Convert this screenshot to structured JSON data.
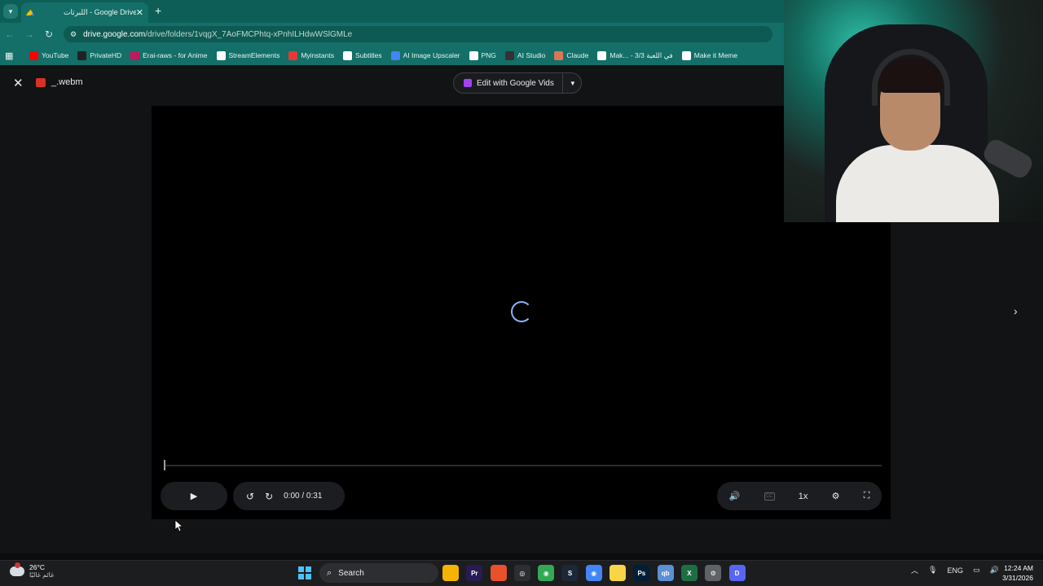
{
  "browser": {
    "tab_title": "اللبرتات - Google Drive",
    "tab_close": "✕",
    "new_tab": "+",
    "url_host": "drive.google.com",
    "url_path": "/drive/folders/1vqgX_7AoFMCPhtq-xPnhILHdwWSlGMLe",
    "bookmarks": [
      {
        "label": "YouTube",
        "color": "#ff0000"
      },
      {
        "label": "PrivateHD",
        "color": "#222222"
      },
      {
        "label": "Erai-raws - for Anime",
        "color": "#c2185b"
      },
      {
        "label": "StreamElements",
        "color": "#ffffff"
      },
      {
        "label": "Myinstants",
        "color": "#e53935"
      },
      {
        "label": "Subtitles",
        "color": "#ffffff"
      },
      {
        "label": "AI Image Upscaler",
        "color": "#4285f4"
      },
      {
        "label": "PNG",
        "color": "#ffffff"
      },
      {
        "label": "AI Studio",
        "color": "#333333"
      },
      {
        "label": "Claude",
        "color": "#d97757"
      },
      {
        "label": "Mak... - 3/3 في اللعبة",
        "color": "#ffffff"
      },
      {
        "label": "Make it Meme",
        "color": "#ffffff"
      }
    ]
  },
  "viewer": {
    "file_name": "_.webm",
    "edit_button": "Edit with Google Vids",
    "time": "0:00 / 0:31",
    "speed": "1x",
    "cc": "CC"
  },
  "taskbar": {
    "temperature": "26°C",
    "weather_text": "غائم غالبًا",
    "search_placeholder": "Search",
    "language": "ENG",
    "time": "12:24 AM",
    "date": "3/31/2026",
    "icons": [
      {
        "name": "file-explorer-icon",
        "color": "#f4b400",
        "glyph": ""
      },
      {
        "name": "premiere-icon",
        "color": "#2a1a54",
        "glyph": "Pr"
      },
      {
        "name": "app-orange-icon",
        "color": "#e8512c",
        "glyph": ""
      },
      {
        "name": "obs-icon",
        "color": "#2d2e31",
        "glyph": "◎"
      },
      {
        "name": "chrome-icon",
        "color": "#34a853",
        "glyph": "◉"
      },
      {
        "name": "steam-icon",
        "color": "#1b2838",
        "glyph": "S"
      },
      {
        "name": "chrome-active-icon",
        "color": "#4285f4",
        "glyph": "◉"
      },
      {
        "name": "sticky-notes-icon",
        "color": "#f7d547",
        "glyph": ""
      },
      {
        "name": "photoshop-icon",
        "color": "#001e36",
        "glyph": "Ps"
      },
      {
        "name": "qbittorrent-icon",
        "color": "#5b8fd6",
        "glyph": "qb"
      },
      {
        "name": "excel-icon",
        "color": "#1d6f42",
        "glyph": "X"
      },
      {
        "name": "settings-icon",
        "color": "#5f6368",
        "glyph": "⚙"
      },
      {
        "name": "discord-icon",
        "color": "#5865f2",
        "glyph": "D"
      }
    ]
  }
}
